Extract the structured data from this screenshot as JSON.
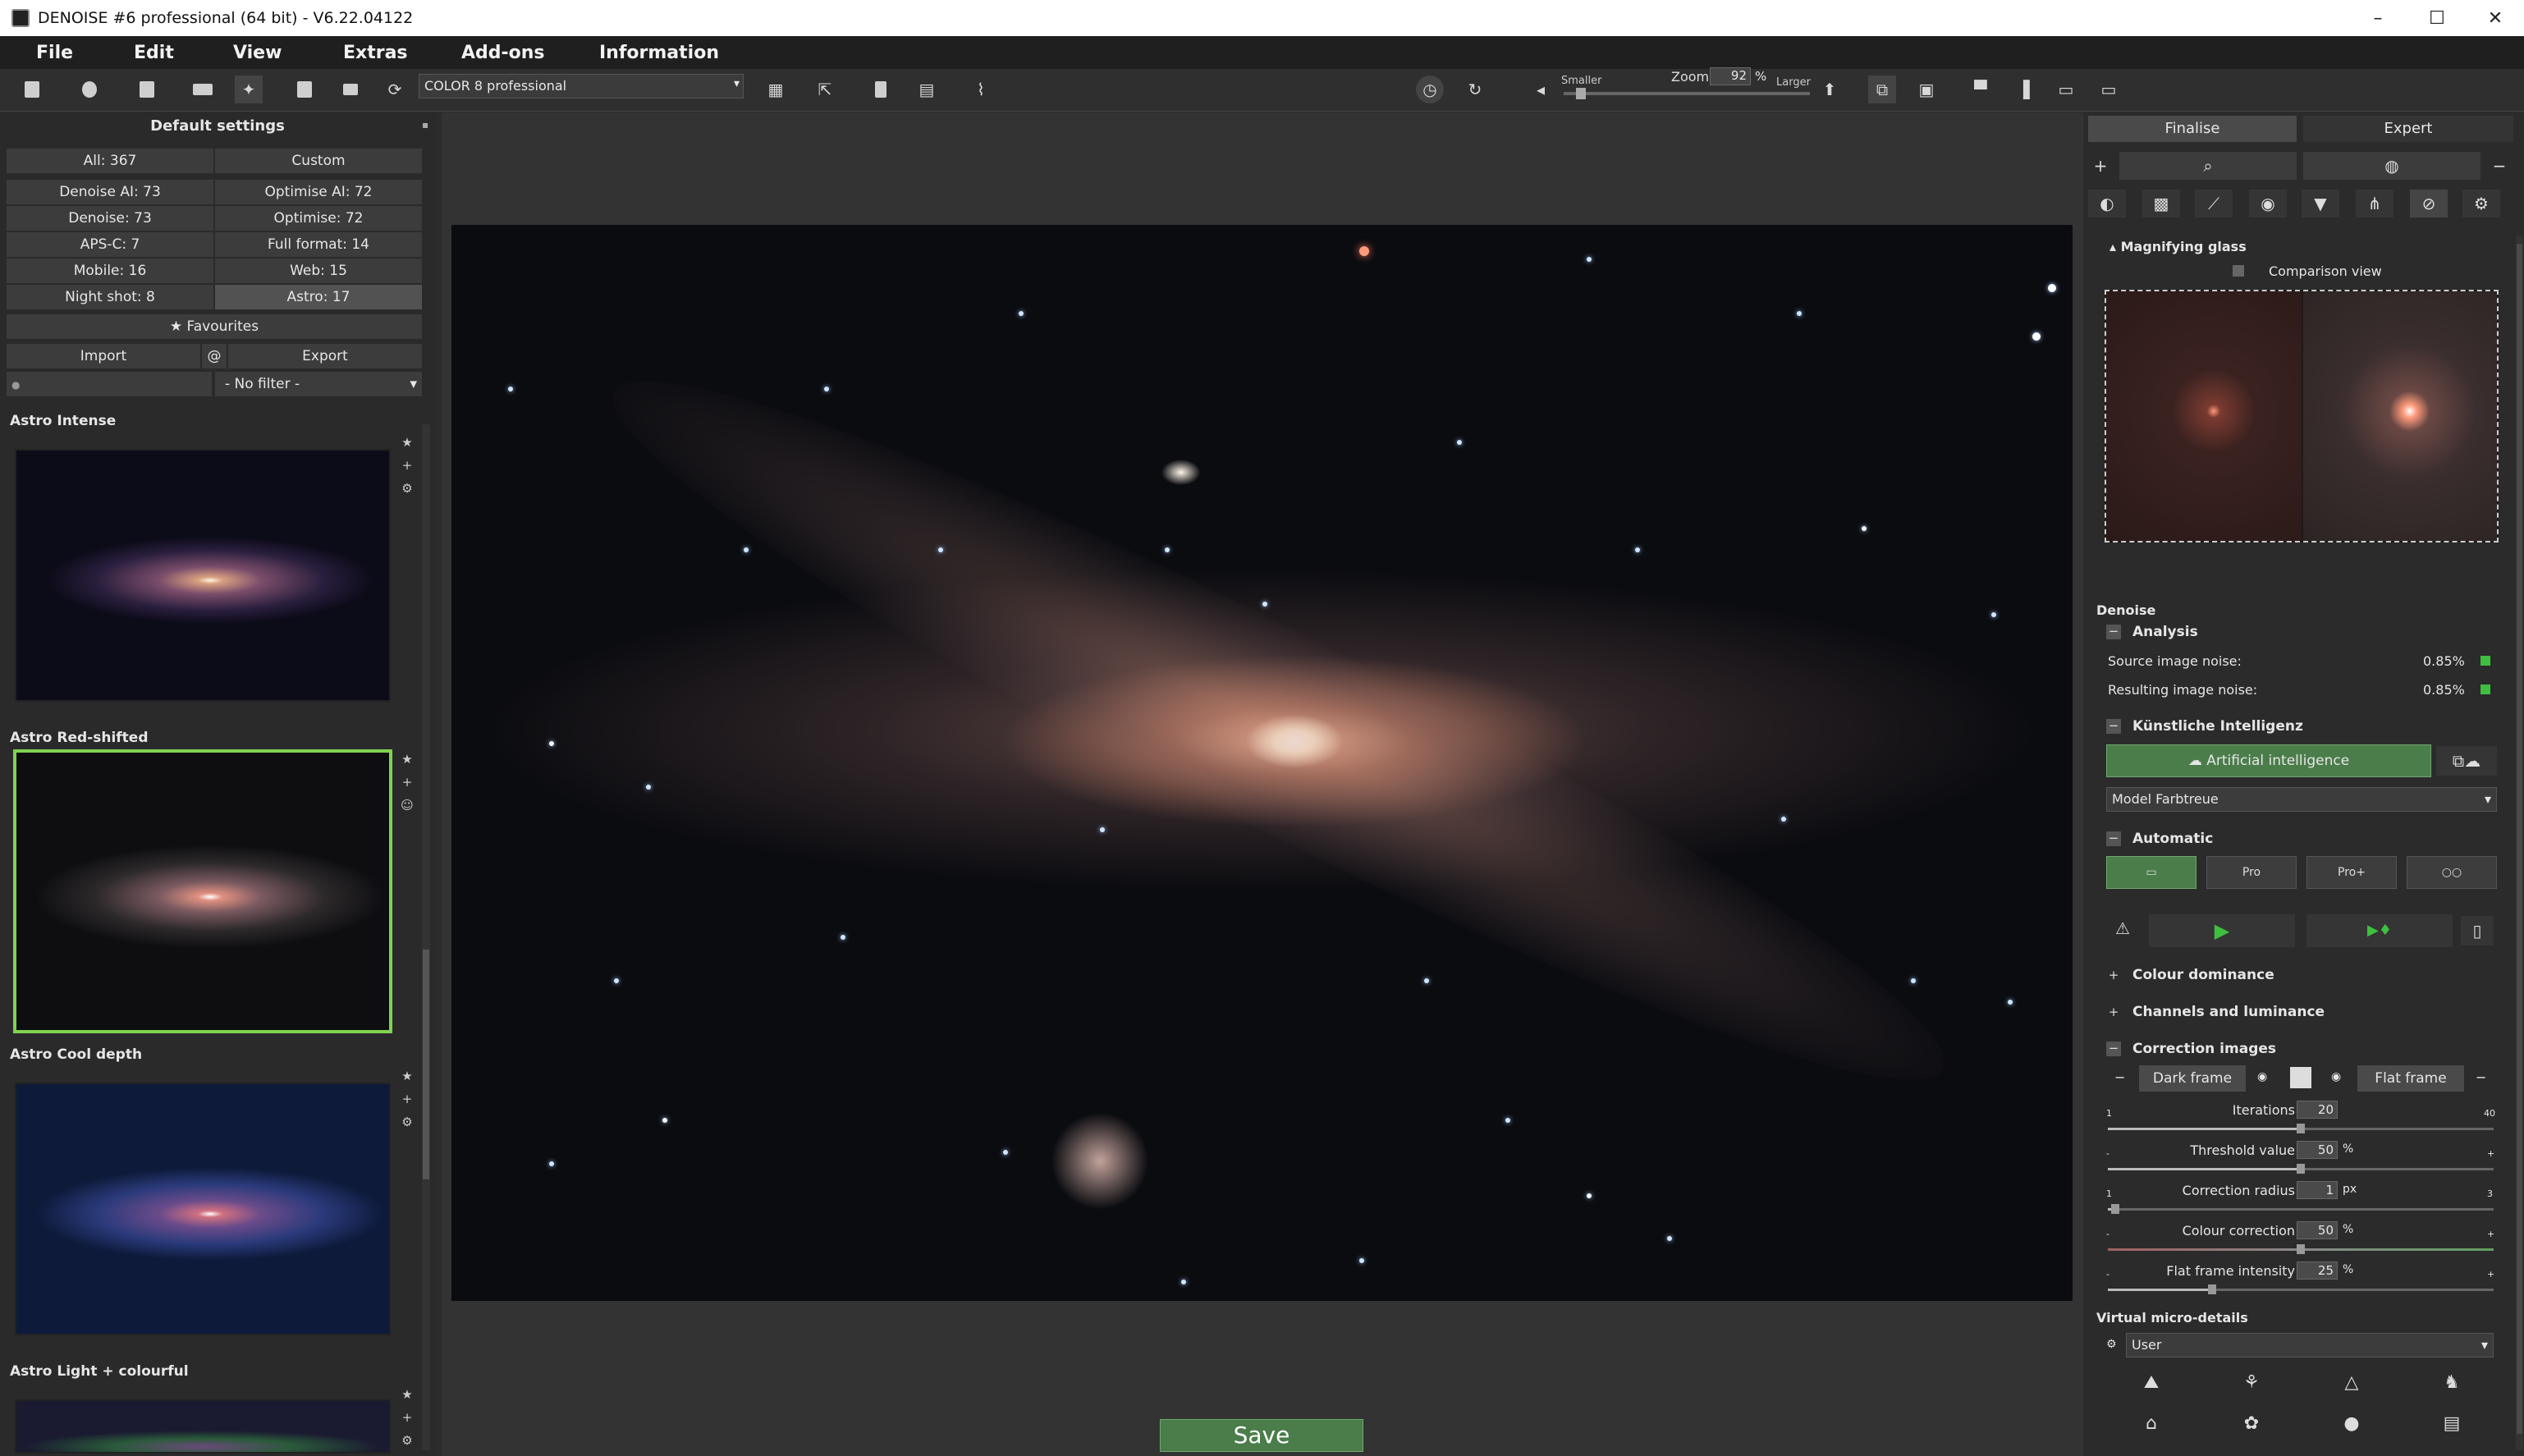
{
  "window": {
    "title": "DENOISE #6 professional (64 bit) - V6.22.04122",
    "minimize": "–",
    "maximize": "☐",
    "close": "✕"
  },
  "menu": [
    "File",
    "Edit",
    "View",
    "Extras",
    "Add-ons",
    "Information"
  ],
  "toolbar": {
    "profile_value": "COLOR 8 professional",
    "zoom_label": "Zoom",
    "zoom_value": "92",
    "zoom_unit": "%",
    "smaller": "Smaller",
    "larger": "Larger",
    "zoom_level": 0.05
  },
  "left": {
    "title": "Default settings",
    "filters": [
      [
        "All: 367",
        "Custom"
      ],
      [
        "Denoise AI: 73",
        "Optimise AI: 72"
      ],
      [
        "Denoise: 73",
        "Optimise: 72"
      ],
      [
        "APS-C: 7",
        "Full format: 14"
      ],
      [
        "Mobile: 16",
        "Web: 15"
      ],
      [
        "Night shot: 8",
        "Astro: 17"
      ]
    ],
    "favourites": "★ Favourites",
    "import": "Import",
    "at": "@",
    "export": "Export",
    "no_filter": "- No filter -",
    "presets": [
      {
        "name": "Astro Intense"
      },
      {
        "name": "Astro Red-shifted"
      },
      {
        "name": "Astro Cool depth"
      },
      {
        "name": "Astro Light + colourful"
      }
    ]
  },
  "center": {
    "save": "Save"
  },
  "right": {
    "tabs": [
      "Finalise",
      "Expert"
    ],
    "magnifier_title": "Magnifying glass",
    "comparison_view": "Comparison view",
    "denoise": "Denoise",
    "analysis": "Analysis",
    "source_noise_label": "Source image noise:",
    "source_noise_value": "0.85%",
    "result_noise_label": "Resulting image noise:",
    "result_noise_value": "0.85%",
    "ai_section": "Künstliche Intelligenz",
    "ai_button": "Artificial intelligence",
    "model": "Model Farbtreue",
    "automatic": "Automatic",
    "mode_labels": [
      "",
      "Pro",
      "Pro+",
      "○○"
    ],
    "colour_dominance": "Colour dominance",
    "channels": "Channels and luminance",
    "correction_images": "Correction images",
    "dark_frame": "Dark frame",
    "flat_frame": "Flat frame",
    "sliders": [
      {
        "label": "Iterations",
        "value": "20",
        "unit": "",
        "min": "1",
        "max": "40",
        "fraction": 0.5
      },
      {
        "label": "Threshold value",
        "value": "50",
        "unit": "%",
        "min": "-",
        "max": "+",
        "fraction": 0.5
      },
      {
        "label": "Correction radius",
        "value": "1",
        "unit": "px",
        "min": "1",
        "max": "3",
        "fraction": 0.02
      },
      {
        "label": "Colour correction",
        "value": "50",
        "unit": "%",
        "min": "-",
        "max": "+",
        "fraction": 0.5
      },
      {
        "label": "Flat frame intensity",
        "value": "25",
        "unit": "%",
        "min": "-",
        "max": "+",
        "fraction": 0.27
      }
    ],
    "vmd_title": "Virtual micro-details",
    "vmd_value": "User"
  },
  "colors": {
    "accent_green": "#4b7d4b",
    "selection_border": "#7fd350",
    "status_green": "#3fbf3f"
  }
}
